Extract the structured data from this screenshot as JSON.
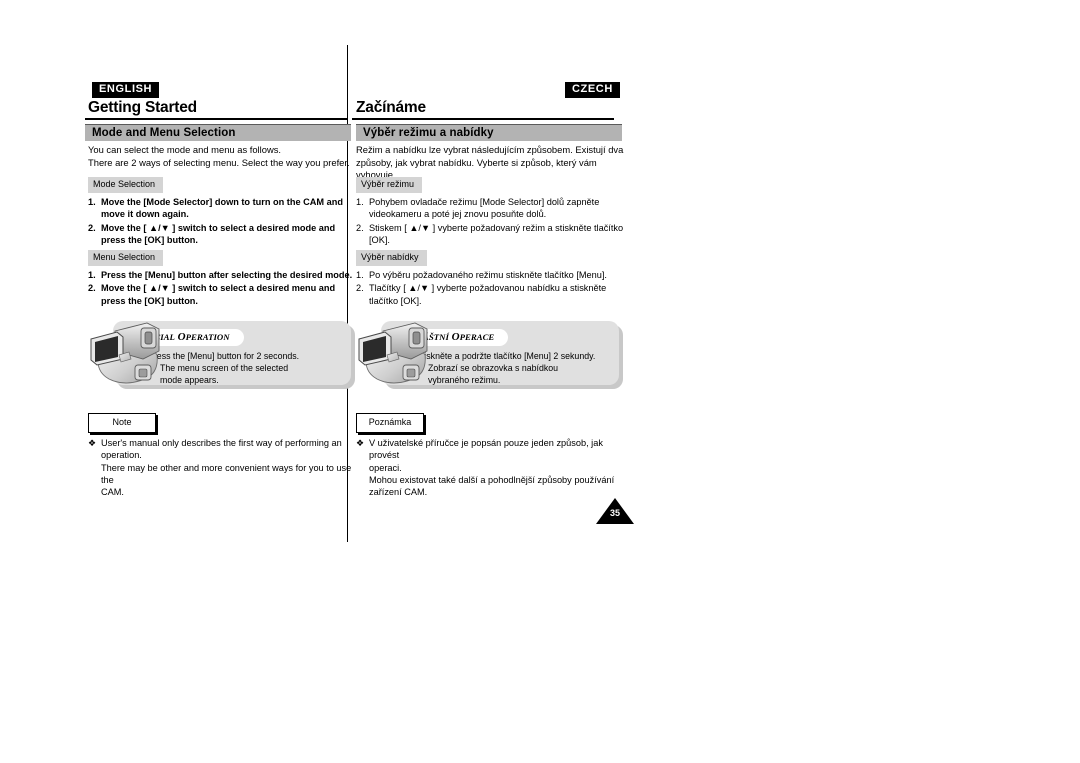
{
  "page": {
    "number": "35"
  },
  "english": {
    "language_badge": "ENGLISH",
    "chapter_title": "Getting Started",
    "section_title": "Mode and Menu Selection",
    "intro_line1": "You can select the mode and menu as follows.",
    "intro_line2": "There are 2 ways of selecting menu. Select the way you prefer.",
    "mode_selection": {
      "chip": "Mode Selection",
      "steps": [
        {
          "num": "1.",
          "text": "Move the [Mode Selector] down to turn on the CAM and move it down again."
        },
        {
          "num": "2.",
          "text": "Move the [ ▲/▼ ] switch to select a desired mode and press the [OK] button."
        }
      ]
    },
    "menu_selection": {
      "chip": "Menu Selection",
      "steps": [
        {
          "num": "1.",
          "text": "Press the [Menu] button after selecting the desired mode."
        },
        {
          "num": "2.",
          "text": "Move the [ ▲/▼ ] switch to select a desired menu and press the [OK] button."
        }
      ]
    },
    "special_operation": {
      "title_first": "S",
      "title_rest1": "PECIAL",
      "title_second": "O",
      "title_rest2": "PERATION",
      "step_num": "1.",
      "step_text": "Press the [Menu] button for 2 seconds.",
      "bullet": "♦",
      "bullet_text_line1": "The menu screen of the selected",
      "bullet_text_line2": "mode appears."
    },
    "note": {
      "label": "Note",
      "bullet": "❖",
      "text_line1": "User's manual only describes the first way of performing an",
      "text_line2": "operation.",
      "text_line3": "There may be other and more convenient ways for you to use the",
      "text_line4": "CAM."
    }
  },
  "czech": {
    "language_badge": "CZECH",
    "chapter_title": "Začínáme",
    "section_title": "Výběr režimu a nabídky",
    "intro_line1": "Režim a nabídku lze vybrat následujícím způsobem. Existují dva",
    "intro_line2": "způsoby, jak vybrat nabídku. Vyberte si způsob, který vám vyhovuje.",
    "mode_selection": {
      "chip": "Výběr režimu",
      "steps": [
        {
          "num": "1.",
          "text": "Pohybem ovladače režimu [Mode Selector] dolů zapněte videokameru a poté jej znovu posuňte dolů."
        },
        {
          "num": "2.",
          "text": "Stiskem [ ▲/▼ ] vyberte požadovaný režim a stiskněte tlačítko [OK]."
        }
      ]
    },
    "menu_selection": {
      "chip": "Výběr nabídky",
      "steps": [
        {
          "num": "1.",
          "text": "Po výběru požadovaného režimu stiskněte tlačítko [Menu]."
        },
        {
          "num": "2.",
          "text": "Tlačítky [ ▲/▼ ] vyberte požadovanou nabídku a stiskněte tlačítko [OK]."
        }
      ]
    },
    "special_operation": {
      "title_first": "Z",
      "title_rest1": "VLÁŠTNÍ",
      "title_second": "O",
      "title_rest2": "PERACE",
      "step_num": "1.",
      "step_text": "Stiskněte a podržte tlačítko [Menu] 2 sekundy.",
      "bullet": "♦",
      "bullet_text_line1": "Zobrazí se obrazovka s nabídkou",
      "bullet_text_line2": "vybraného režimu."
    },
    "note": {
      "label": "Poznámka",
      "bullet": "❖",
      "text_line1": "V uživatelské příručce je popsán pouze jeden způsob, jak provést",
      "text_line2": "operaci.",
      "text_line3": "Mohou existovat také další a pohodlnější způsoby používání",
      "text_line4": "zařízení CAM."
    }
  },
  "colors": {
    "section_bar": "#b3b3b3",
    "chip": "#d4d4d4",
    "panel": "#e0e0e0",
    "panel_shadow": "#c8c8c8",
    "ink": "#000000"
  }
}
